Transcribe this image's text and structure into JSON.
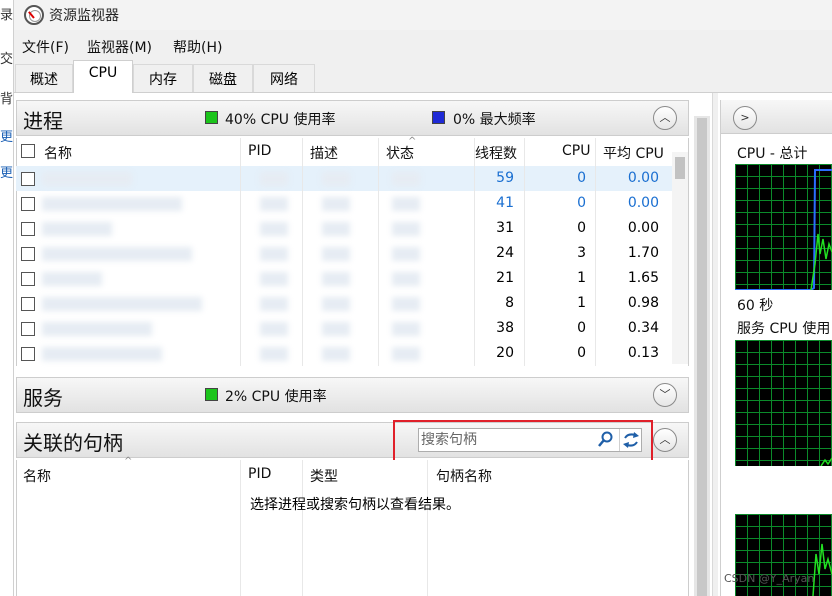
{
  "window": {
    "title": "资源监视器"
  },
  "menu": [
    "文件(F)",
    "监视器(M)",
    "帮助(H)"
  ],
  "tabs": [
    "概述",
    "CPU",
    "内存",
    "磁盘",
    "网络"
  ],
  "active_tab": "CPU",
  "processes": {
    "title": "进程",
    "cpu_usage": "40% CPU 使用率",
    "max_freq": "0% 最大频率",
    "columns": [
      "名称",
      "PID",
      "描述",
      "状态",
      "线程数",
      "CPU",
      "平均 CPU"
    ],
    "rows": [
      {
        "threads": "59",
        "cpu": "0",
        "avg": "0.00",
        "highlight": true
      },
      {
        "threads": "41",
        "cpu": "0",
        "avg": "0.00",
        "highlight": false,
        "blue": true
      },
      {
        "threads": "31",
        "cpu": "0",
        "avg": "0.00"
      },
      {
        "threads": "24",
        "cpu": "3",
        "avg": "1.70"
      },
      {
        "threads": "21",
        "cpu": "1",
        "avg": "1.65"
      },
      {
        "threads": "8",
        "cpu": "1",
        "avg": "0.98"
      },
      {
        "threads": "38",
        "cpu": "0",
        "avg": "0.34"
      },
      {
        "threads": "20",
        "cpu": "0",
        "avg": "0.13"
      }
    ]
  },
  "services": {
    "title": "服务",
    "cpu_usage": "2% CPU 使用率"
  },
  "handles": {
    "title": "关联的句柄",
    "search_placeholder": "搜索句柄",
    "columns": [
      "名称",
      "PID",
      "类型",
      "句柄名称"
    ],
    "empty_message": "选择进程或搜索句柄以查看结果。"
  },
  "right_pane": {
    "cpu_total_label": "CPU - 总计",
    "time_label": "60 秒",
    "service_cpu_label": "服务 CPU 使用"
  },
  "watermark": "CSDN @Y_Aryan",
  "colors": {
    "highlight_row": "#e5f1fb",
    "blue_text": "#1a6fd1",
    "red_box": "#e0202a"
  }
}
